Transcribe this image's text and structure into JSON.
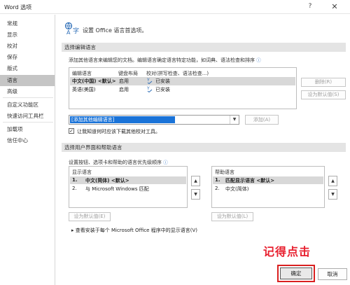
{
  "window": {
    "title": "Word 选项",
    "help_glyph": "?",
    "close_glyph": "✕"
  },
  "sidebar": {
    "items": [
      {
        "label": "常规"
      },
      {
        "label": "显示"
      },
      {
        "label": "校对"
      },
      {
        "label": "保存"
      },
      {
        "label": "版式"
      },
      {
        "label": "语言",
        "active": true
      },
      {
        "label": "高级"
      },
      {
        "label": "自定义功能区"
      },
      {
        "label": "快速访问工具栏"
      },
      {
        "label": "加载项"
      },
      {
        "label": "信任中心"
      }
    ]
  },
  "header": {
    "text": "设置 Office 语言首选项。",
    "icon": "language-icon"
  },
  "editing": {
    "section_title": "选择编辑语言",
    "description": "添加其他语言来编辑您的文档。编辑语言确定语言特定功能，如词典、语法检查和排序",
    "columns": [
      "编辑语言",
      "键盘布局",
      "校对(拼写检查、语法检查...)"
    ],
    "rows": [
      {
        "language": "中文(中国) <默认>",
        "keyboard": "启用",
        "proofing": "已安装"
      },
      {
        "language": "英语(美国)",
        "keyboard": "启用",
        "proofing": "已安装"
      }
    ],
    "remove_label": "删除(R)",
    "set_default_label": "设为默认值(S)",
    "add_dropdown_value": "[添加其他编辑语言]",
    "add_label": "添加(A)",
    "checkbox_label": "让我知道何时应该下载其他校对工具。",
    "checkbox_checked": true
  },
  "ui_lang": {
    "section_title": "选择用户界面和帮助语言",
    "description": "设置按钮、选项卡和帮助的语言优先级顺序",
    "display": {
      "title": "显示语言",
      "items": [
        {
          "num": "1.",
          "label": "中文(简体) <默认>"
        },
        {
          "num": "2.",
          "label": "与 Microsoft Windows 匹配"
        }
      ],
      "set_default_label": "设为默认值(E)"
    },
    "help": {
      "title": "帮助语言",
      "items": [
        {
          "num": "1.",
          "label": "匹配显示语言 <默认>"
        },
        {
          "num": "2.",
          "label": "中文(简体)"
        }
      ],
      "set_default_label": "设为默认值(L)"
    },
    "link_text": "查看安装于每个 Microsoft Office 程序中的显示语言(V)"
  },
  "footer": {
    "annotation": "记得点击",
    "ok_label": "确定",
    "cancel_label": "取消"
  },
  "colors": {
    "accent": "#1a73d8",
    "annotation": "#e8202f",
    "selected_row": "#d8d8d8"
  }
}
